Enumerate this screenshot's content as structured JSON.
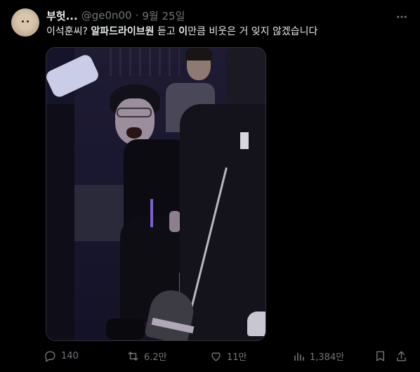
{
  "tweet": {
    "author_name": "부헛...",
    "handle": "@ge0n00",
    "separator": "·",
    "date": "9월 25일",
    "text_parts": {
      "p1": "이석훈씨? ",
      "p2": "알파드라이브원",
      "p3": " 듣고 ",
      "p4": "이",
      "p5": "만큼 비웃은 거 잊지 않겠습니다"
    }
  },
  "actions": {
    "replies": "140",
    "retweets": "6.2만",
    "likes": "11만",
    "views": "1,384만"
  },
  "icons": {
    "more": "more-icon",
    "reply": "reply-icon",
    "retweet": "retweet-icon",
    "like": "heart-icon",
    "views": "views-icon",
    "bookmark": "bookmark-icon",
    "share": "share-icon"
  },
  "colors": {
    "background": "#000000",
    "text": "#e7e9ea",
    "muted": "#71767b"
  }
}
